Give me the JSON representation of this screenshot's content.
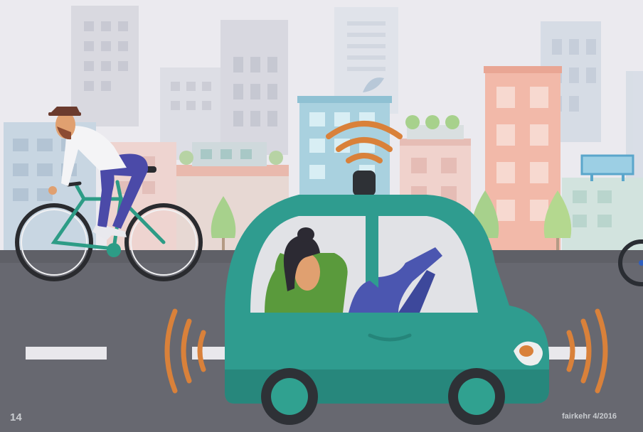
{
  "illustration": {
    "page_number": "14",
    "credit": "fairkehr 4/2016"
  },
  "colors": {
    "sky": "#e9e8ee",
    "road": "#66676d",
    "car_body": "#2f9c8f",
    "sensor_wave": "#d9813a",
    "cyclist_shirt": "#f4f4f6",
    "cyclist_pants": "#4b4aa8",
    "bike_frame": "#2d9c86",
    "passenger_top": "#5a9a3c",
    "passenger_pants": "#4b56b0"
  },
  "scene": {
    "description_icons": [
      "city-skyline-icon",
      "cyclist-icon",
      "self-driving-car-icon",
      "sensor-waves-icon",
      "tree-icon",
      "billboard-icon"
    ]
  }
}
